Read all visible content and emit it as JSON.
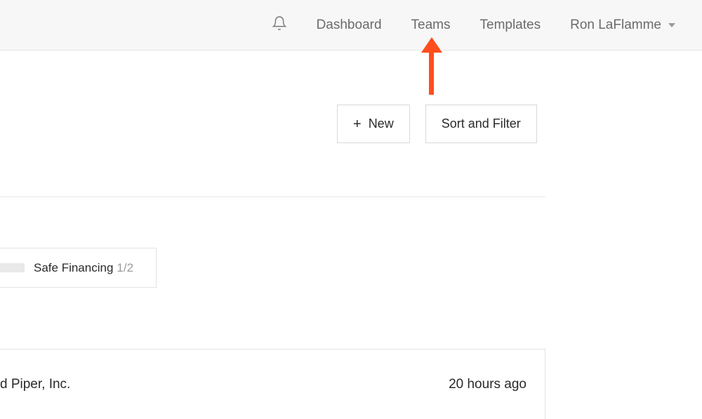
{
  "nav": {
    "dashboard": "Dashboard",
    "teams": "Teams",
    "templates": "Templates",
    "user_name": "Ron LaFlamme"
  },
  "actions": {
    "new_label": "New",
    "sort_filter_label": "Sort and Filter"
  },
  "card": {
    "title": "Safe Financing",
    "fraction": "1/2"
  },
  "row": {
    "company": "d Piper, Inc.",
    "time": "20 hours ago"
  }
}
